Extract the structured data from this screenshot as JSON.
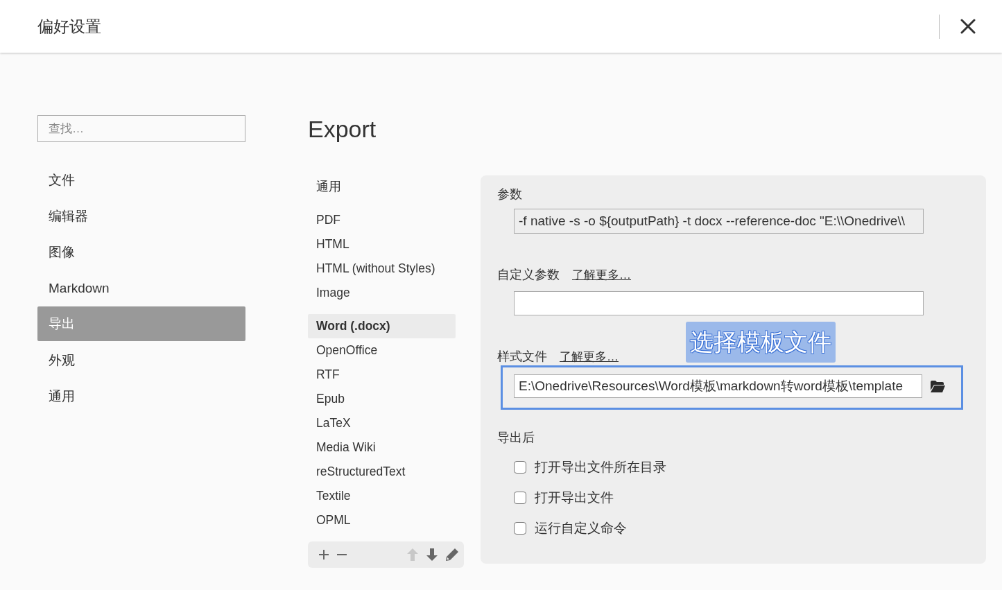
{
  "window": {
    "title": "偏好设置"
  },
  "sidebar": {
    "search": {
      "placeholder": "查找…"
    },
    "items": [
      {
        "label": "文件",
        "selected": false
      },
      {
        "label": "编辑器",
        "selected": false
      },
      {
        "label": "图像",
        "selected": false
      },
      {
        "label": "Markdown",
        "selected": false
      },
      {
        "label": "导出",
        "selected": true
      },
      {
        "label": "外观",
        "selected": false
      },
      {
        "label": "通用",
        "selected": false
      }
    ]
  },
  "page": {
    "title": "Export"
  },
  "format_groups": [
    {
      "items": [
        {
          "label": "通用",
          "selected": false
        }
      ]
    },
    {
      "items": [
        {
          "label": "PDF",
          "selected": false
        },
        {
          "label": "HTML",
          "selected": false
        },
        {
          "label": "HTML (without Styles)",
          "selected": false
        },
        {
          "label": "Image",
          "selected": false
        }
      ]
    },
    {
      "items": [
        {
          "label": "Word (.docx)",
          "selected": true
        },
        {
          "label": "OpenOffice",
          "selected": false
        },
        {
          "label": "RTF",
          "selected": false
        },
        {
          "label": "Epub",
          "selected": false
        },
        {
          "label": "LaTeX",
          "selected": false
        },
        {
          "label": "Media Wiki",
          "selected": false
        },
        {
          "label": "reStructuredText",
          "selected": false
        },
        {
          "label": "Textile",
          "selected": false
        },
        {
          "label": "OPML",
          "selected": false
        }
      ]
    }
  ],
  "format_toolbar": [
    {
      "kind": "add",
      "disabled": false
    },
    {
      "kind": "remove",
      "disabled": false
    },
    {
      "kind": "move_up",
      "disabled": true
    },
    {
      "kind": "move_down",
      "disabled": false
    },
    {
      "kind": "edit",
      "disabled": false
    }
  ],
  "settings": {
    "arguments": {
      "label": "参数",
      "value": "-f native -s -o ${outputPath} -t docx --reference-doc \"E:\\\\Onedrive\\\\"
    },
    "custom_arguments": {
      "label": "自定义参数",
      "link": "了解更多…"
    },
    "style_file": {
      "label": "样式文件",
      "link": "了解更多…",
      "value": "E:\\Onedrive\\Resources\\Word模板\\markdown转word模板\\template"
    },
    "after_export": {
      "label": "导出后",
      "options": [
        {
          "label": "打开导出文件所在目录",
          "checked": false
        },
        {
          "label": "打开导出文件",
          "checked": false
        },
        {
          "label": "运行自定义命令",
          "checked": false
        }
      ]
    }
  },
  "annotation": {
    "text": "选择模板文件"
  }
}
